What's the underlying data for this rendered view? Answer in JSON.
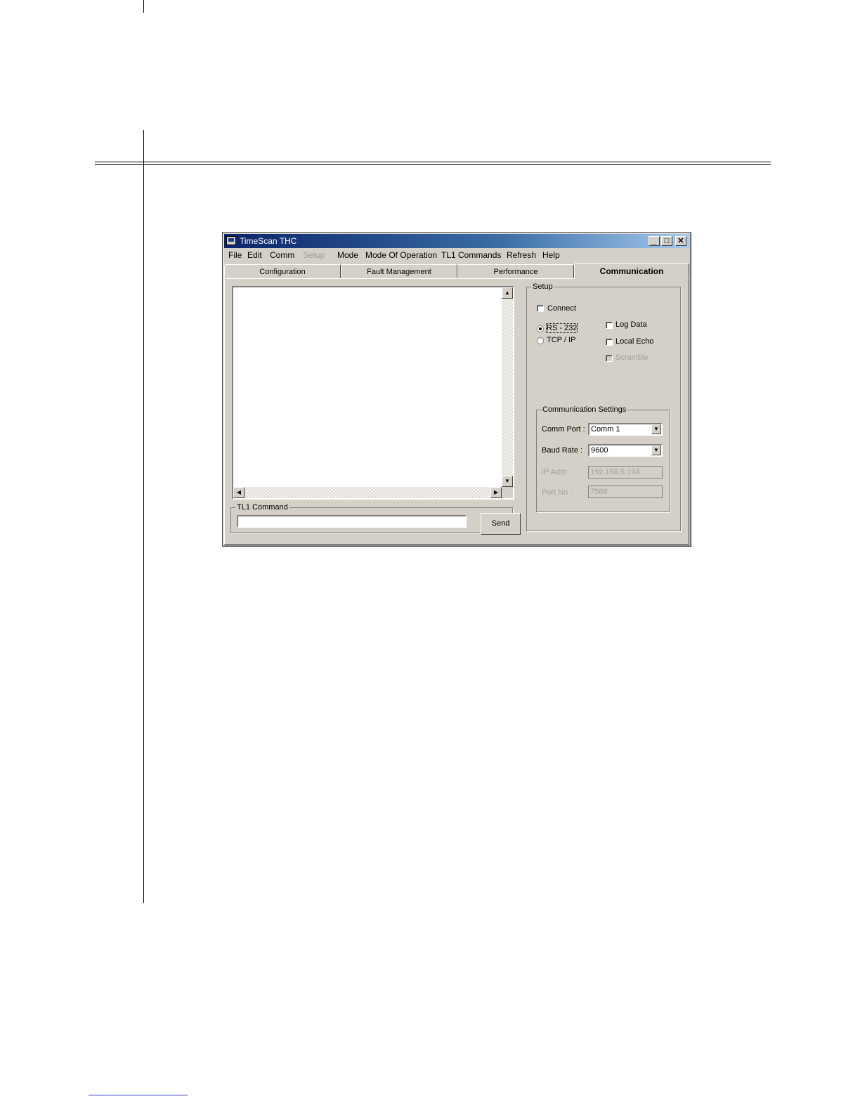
{
  "window": {
    "title": "TimeScan THC"
  },
  "menu": {
    "file": "File",
    "edit": "Edit",
    "comm": "Comm",
    "setup": "Setup",
    "mode": "Mode",
    "mode_of_operation": "Mode Of Operation",
    "tl1_commands": "TL1 Commands",
    "refresh": "Refresh",
    "help": "Help"
  },
  "tabs": [
    "Configuration",
    "Fault Management",
    "Performance",
    "Communication"
  ],
  "active_tab": "Communication",
  "tl1": {
    "legend": "TL1 Command",
    "value": "",
    "send_label": "Send"
  },
  "setup": {
    "legend": "Setup",
    "connect_label": "Connect",
    "connect_checked": false,
    "rs232_label": "RS - 232",
    "tcpip_label": "TCP / IP",
    "selected_interface": "RS - 232",
    "log_data_label": "Log Data",
    "local_echo_label": "Local Echo",
    "scramble_label": "Scramble"
  },
  "comm_settings": {
    "legend": "Communication Settings",
    "comm_port_label": "Comm Port :",
    "comm_port_value": "Comm 1",
    "baud_rate_label": "Baud Rate :",
    "baud_rate_value": "9600",
    "ip_addr_label": "IP Addr :",
    "ip_addr_value": "192.168.5.194",
    "port_no_label": "Port No :",
    "port_no_value": "7588"
  }
}
